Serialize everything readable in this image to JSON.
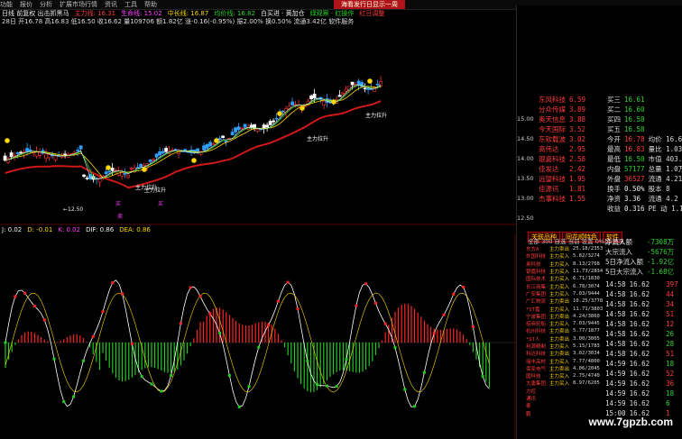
{
  "menu": [
    "功能",
    "报价",
    "分析",
    "扩展市场行情",
    "资讯",
    "工具",
    "帮助"
  ],
  "top_badge": "海看发行日显示一周",
  "header_line1": [
    {
      "text": "日线 前复权 出击抓黑马",
      "color": "#eeeeee"
    },
    {
      "text": "主力线: 16.31",
      "color": "#ff3b3b"
    },
    {
      "text": "生命线: 15.02",
      "color": "#ff40ff"
    },
    {
      "text": "中长线: 16.87",
      "color": "#ffd800"
    },
    {
      "text": "均价线: 16.82",
      "color": "#2cd32c"
    },
    {
      "text": "白买进 · 黄加仓",
      "color": "#eeeeee"
    },
    {
      "text": "绿观察 · 红操作",
      "color": "#2cd32c"
    },
    {
      "text": "红日调整",
      "color": "#ff3b3b"
    }
  ],
  "header_line2": "28日 开16.78 高16.83 低16.50 收16.62 量109706 额1.82亿 涨-0.16(-0.95%) 振2.00% 换0.50% 流通3.42亿 软件服务",
  "main_chart": {
    "ticks": [
      "15.00",
      "14.50",
      "14.00",
      "13.50",
      "13.00",
      "12.50"
    ],
    "low_label": "←12.50",
    "markers": [
      "主力拉升",
      "主力拉升",
      "主力拉升",
      "主力拉升"
    ],
    "market_labels": [
      "买",
      "买",
      "卖"
    ]
  },
  "sub_header": [
    {
      "text": "J: 0.02",
      "color": "#eeeeee"
    },
    {
      "text": "D: -0.01",
      "color": "#ffd800"
    },
    {
      "text": "K: 0.02",
      "color": "#ff40ff"
    },
    {
      "text": "DIF: 0.86",
      "color": "#eeeeee"
    },
    {
      "text": "DEA: 0.86",
      "color": "#ffd800"
    }
  ],
  "sub_ticks": [
    "1.00",
    "0.80",
    "0.60",
    "0.40",
    "0.20",
    "0.00",
    "-0.20"
  ],
  "sub_ticks_right": [
    "0.80",
    "0.40",
    "0.00",
    "-0.40",
    "-0.80"
  ],
  "plate_list": [
    {
      "name": "东风科技",
      "val": "6.59"
    },
    {
      "name": "分众传媒",
      "val": "3.89"
    },
    {
      "name": "奥天信息",
      "val": "3.88"
    },
    {
      "name": "今天国际",
      "val": "3.52"
    },
    {
      "name": "东软载波",
      "val": "3.02"
    },
    {
      "name": "高伟达",
      "val": "2.95"
    },
    {
      "name": "银嘉科技",
      "val": "2.58"
    },
    {
      "name": "佳发达",
      "val": "2.42"
    },
    {
      "name": "远望科技",
      "val": "1.95"
    },
    {
      "name": "佳源讯",
      "val": "1.81"
    },
    {
      "name": "杰事科技",
      "val": "1.55"
    }
  ],
  "plate_ticks": [
    "15.00",
    "14.50",
    "14.00",
    "13.50",
    "13.00",
    "12.50"
  ],
  "quote": [
    {
      "l": "买三",
      "v": "16.61",
      "c": "#2cd32c",
      "x": ""
    },
    {
      "l": "买二",
      "v": "16.60",
      "c": "#2cd32c",
      "x": ""
    },
    {
      "l": "买四",
      "v": "16.58",
      "c": "#2cd32c",
      "x": ""
    },
    {
      "l": "买五",
      "v": "16.58",
      "c": "#2cd32c",
      "x": ""
    },
    {
      "l": "今开",
      "v": "16.78",
      "c": "#ff3b3b",
      "x": "均价 16.67"
    },
    {
      "l": "最高",
      "v": "16.83",
      "c": "#ff3b3b",
      "x": "量比 1.03"
    },
    {
      "l": "最低",
      "v": "16.50",
      "c": "#2cd32c",
      "x": "市值 403.7"
    },
    {
      "l": "内盘",
      "v": "57177",
      "c": "#2cd32c",
      "x": "总量 1.0万"
    },
    {
      "l": "外盘",
      "v": "36527",
      "c": "#ff3b3b",
      "x": "流通 4.21万"
    },
    {
      "l": "换手",
      "v": "0.50%",
      "c": "#eeeeee",
      "x": "股本 8"
    },
    {
      "l": "净资",
      "v": "3.36",
      "c": "#eeeeee",
      "x": "流通 4.2"
    },
    {
      "l": "收益",
      "v": "0.316",
      "c": "#eeeeee",
      "x": "PE 动 1.1"
    }
  ],
  "tabs": [
    "关联品种",
    "同花顺特色",
    "软件"
  ],
  "tab_sub": "全部  300  自选  当前  设置  0%比  总况",
  "flow": [
    {
      "l": "净流入额",
      "v": "-7308万",
      "c": "#2cd32c"
    },
    {
      "l": "大宗流入",
      "v": "-5676万",
      "c": "#2cd32c"
    },
    {
      "l": "5日净流入额",
      "v": "-1.92亿",
      "c": "#2cd32c"
    },
    {
      "l": "5日大宗流入",
      "v": "-1.68亿",
      "c": "#2cd32c"
    }
  ],
  "news": [
    {
      "n": "东方A",
      "t": "主力卖出",
      "v": "25.18/2353"
    },
    {
      "n": "外国科技",
      "t": "主力买入",
      "v": "5.82/3274"
    },
    {
      "n": "奥科技",
      "t": "主力买入",
      "v": "8.13/2768"
    },
    {
      "n": "银嘉科技",
      "t": "主力买入",
      "v": "11.73/2834"
    },
    {
      "n": "国际技术",
      "t": "主力买入",
      "v": "6.71/1830"
    },
    {
      "n": "长江商集",
      "t": "主力买入",
      "v": "6.78/3074"
    },
    {
      "n": "广安集团",
      "t": "主力买入",
      "v": "7.03/9444"
    },
    {
      "n": "广汇物流",
      "t": "主力卖出",
      "v": "10.25/3778"
    },
    {
      "n": "*ST嘉",
      "t": "主力买入",
      "v": "11.71/3803"
    },
    {
      "n": "宁波集团",
      "t": "主力卖出",
      "v": "4.24/3860"
    },
    {
      "n": "招商轮船",
      "t": "主力买入",
      "v": "7.03/9445"
    },
    {
      "n": "杭州科技",
      "t": "主力卖出",
      "v": "5.77/1877"
    },
    {
      "n": "*ST人",
      "t": "主力卖出",
      "v": "3.00/3005"
    },
    {
      "n": "利源精制",
      "t": "主力买入",
      "v": "5.15/1783"
    },
    {
      "n": "科达科技",
      "t": "主力卖出",
      "v": "3.02/3034"
    },
    {
      "n": "瑞丰高材",
      "t": "主力买入",
      "v": "7.77/4800"
    },
    {
      "n": "保变电气",
      "t": "主力卖出",
      "v": "4.06/2045"
    },
    {
      "n": "国科技",
      "t": "主力买入",
      "v": "2.75/4740"
    },
    {
      "n": "大唐集团",
      "t": "主力买入",
      "v": "8.97/6205"
    },
    {
      "n": "力控",
      "t": "",
      "v": ""
    },
    {
      "n": "通讯",
      "t": "",
      "v": ""
    },
    {
      "n": "泰",
      "t": "",
      "v": ""
    },
    {
      "n": "鹏",
      "t": "",
      "v": ""
    }
  ],
  "ticks_right": [
    {
      "t": "14:58",
      "p": "16.62",
      "v": "397",
      "c": "#ff3b3b"
    },
    {
      "t": "14:58",
      "p": "16.62",
      "v": "44",
      "c": "#ff3b3b"
    },
    {
      "t": "14:58",
      "p": "16.62",
      "v": "34",
      "c": "#ff3b3b"
    },
    {
      "t": "14:58",
      "p": "16.62",
      "v": "51",
      "c": "#ff3b3b"
    },
    {
      "t": "14:58",
      "p": "16.62",
      "v": "12",
      "c": "#ff3b3b"
    },
    {
      "t": "14:58",
      "p": "16.62",
      "v": "26",
      "c": "#2cd32c"
    },
    {
      "t": "14:58",
      "p": "16.62",
      "v": "28",
      "c": "#2cd32c"
    },
    {
      "t": "14:58",
      "p": "16.62",
      "v": "51",
      "c": "#ff3b3b"
    },
    {
      "t": "14:59",
      "p": "16.62",
      "v": "18",
      "c": "#2cd32c"
    },
    {
      "t": "14:59",
      "p": "16.62",
      "v": "52",
      "c": "#ff3b3b"
    },
    {
      "t": "14:59",
      "p": "16.62",
      "v": "36",
      "c": "#ff3b3b"
    },
    {
      "t": "14:59",
      "p": "16.62",
      "v": "18",
      "c": "#2cd32c"
    },
    {
      "t": "14:59",
      "p": "16.62",
      "v": "6",
      "c": "#2cd32c"
    },
    {
      "t": "15:00",
      "p": "16.62",
      "v": "1",
      "c": "#ff3b3b"
    }
  ],
  "watermark": "www.7gpzb.com"
}
